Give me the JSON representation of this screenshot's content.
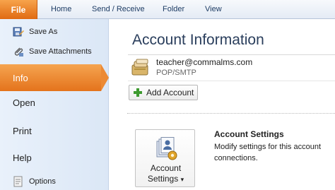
{
  "ribbon": {
    "file_tab": "File",
    "tabs": [
      "Home",
      "Send / Receive",
      "Folder",
      "View"
    ]
  },
  "nav": {
    "save_as": "Save As",
    "save_attachments": "Save Attachments",
    "info": "Info",
    "open": "Open",
    "print": "Print",
    "help": "Help",
    "options": "Options"
  },
  "content": {
    "title": "Account Information",
    "account": {
      "email": "teacher@commalms.com",
      "type": "POP/SMTP"
    },
    "add_account_label": "Add Account",
    "account_settings": {
      "button_line1": "Account",
      "button_line2": "Settings",
      "dropdown_glyph": "▾",
      "heading": "Account Settings",
      "desc_line1": "Modify settings for this account",
      "desc_line2": "connections."
    }
  },
  "colors": {
    "file_tab": "#e06a12",
    "info_highlight": "#ec8a34",
    "title_text": "#2a3e5c"
  }
}
